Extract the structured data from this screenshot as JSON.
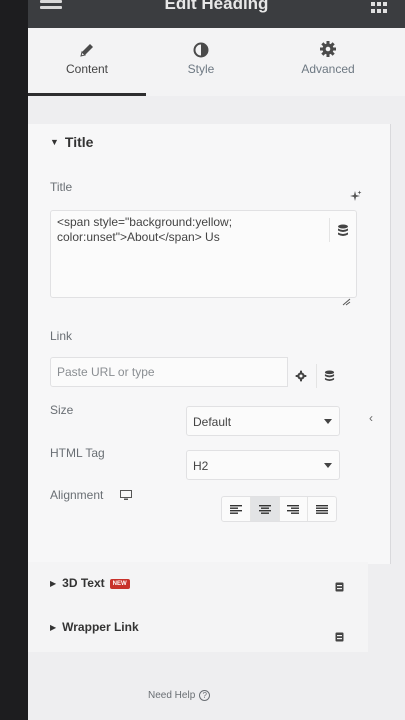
{
  "header": {
    "title": "Edit Heading",
    "menu_icon": "hamburger-icon",
    "apps_icon": "grid-icon"
  },
  "tabs": [
    {
      "label": "Content",
      "icon": "pencil-icon",
      "active": true
    },
    {
      "label": "Style",
      "icon": "contrast-icon",
      "active": false
    },
    {
      "label": "Advanced",
      "icon": "gear-icon",
      "active": false
    }
  ],
  "section": {
    "title": "Title",
    "fields": {
      "title_label": "Title",
      "title_value": "<span style=\"background:yellow; color:unset\">About</span> Us",
      "link_label": "Link",
      "link_placeholder": "Paste URL or type",
      "size_label": "Size",
      "size_value": "Default",
      "html_tag_label": "HTML Tag",
      "html_tag_value": "H2",
      "alignment_label": "Alignment",
      "alignment_options": [
        "left",
        "center",
        "right",
        "justify"
      ],
      "alignment_selected": "center"
    }
  },
  "collapsed_sections": [
    {
      "title": "3D Text",
      "badge": "NEW"
    },
    {
      "title": "Wrapper Link",
      "badge": ""
    }
  ],
  "footer": {
    "help": "Need Help"
  }
}
